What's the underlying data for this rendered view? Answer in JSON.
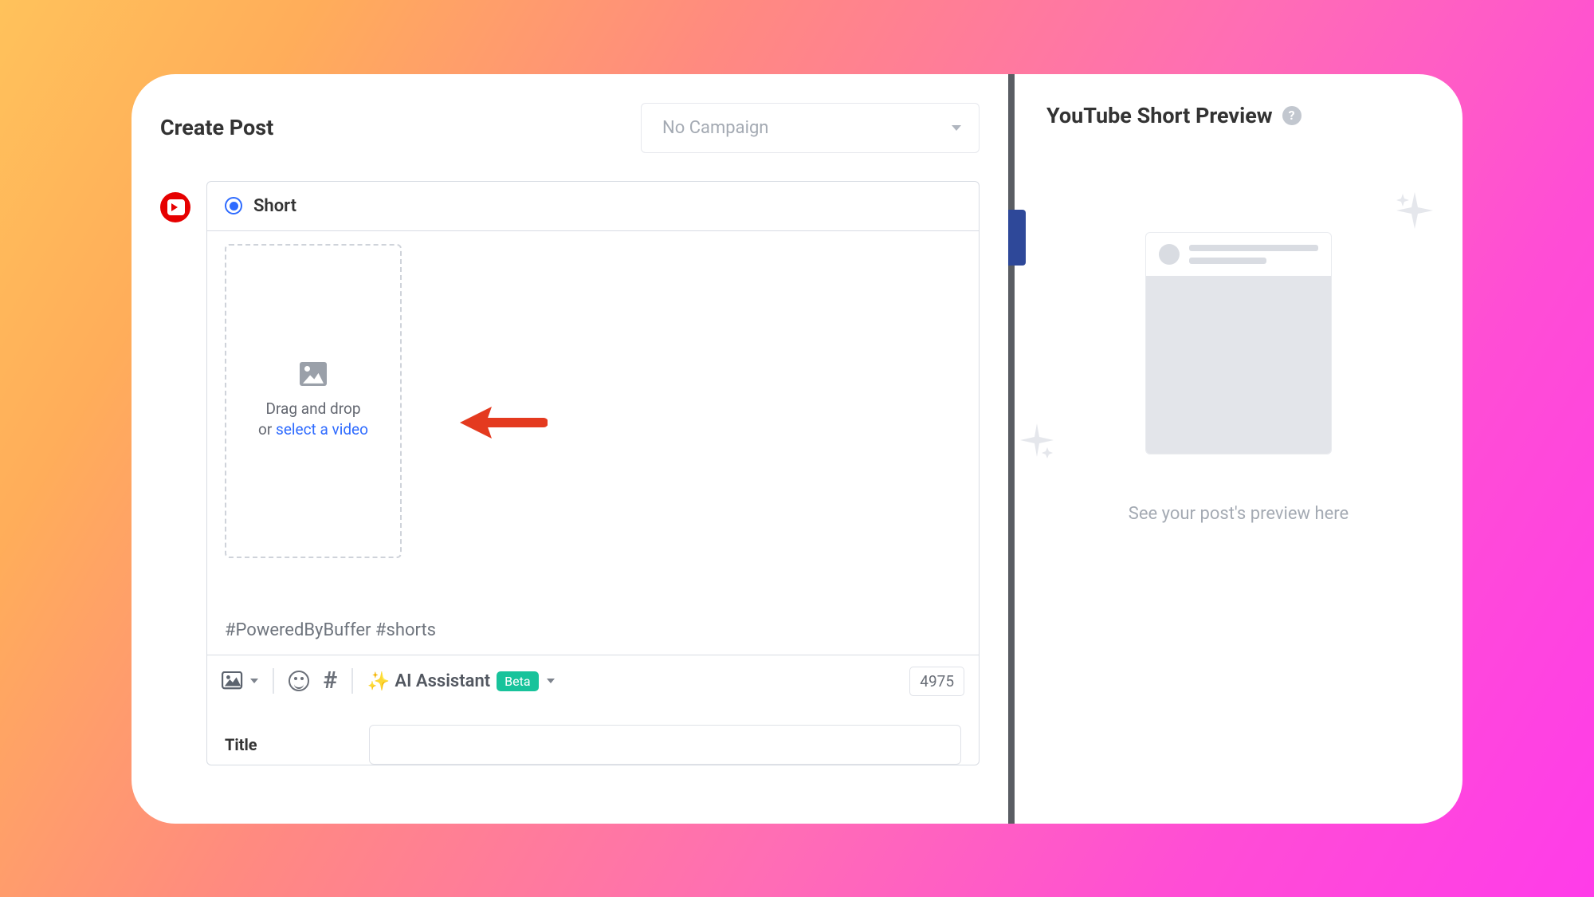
{
  "header": {
    "title": "Create Post",
    "campaign_placeholder": "No Campaign"
  },
  "composer": {
    "type_label": "Short",
    "upload_line1": "Drag and drop",
    "upload_or": "or ",
    "upload_link": "select a video",
    "hashtags": "#PoweredByBuffer #shorts",
    "ai_label": "AI Assistant",
    "beta_label": "Beta",
    "char_count": "4975"
  },
  "fields": {
    "title_label": "Title",
    "title_value": ""
  },
  "preview": {
    "title": "YouTube Short Preview",
    "hint": "See your post's preview here"
  },
  "colors": {
    "youtube": "#e60000",
    "link": "#2e6bff",
    "beta": "#18c39b",
    "arrow": "#e43a1f"
  }
}
